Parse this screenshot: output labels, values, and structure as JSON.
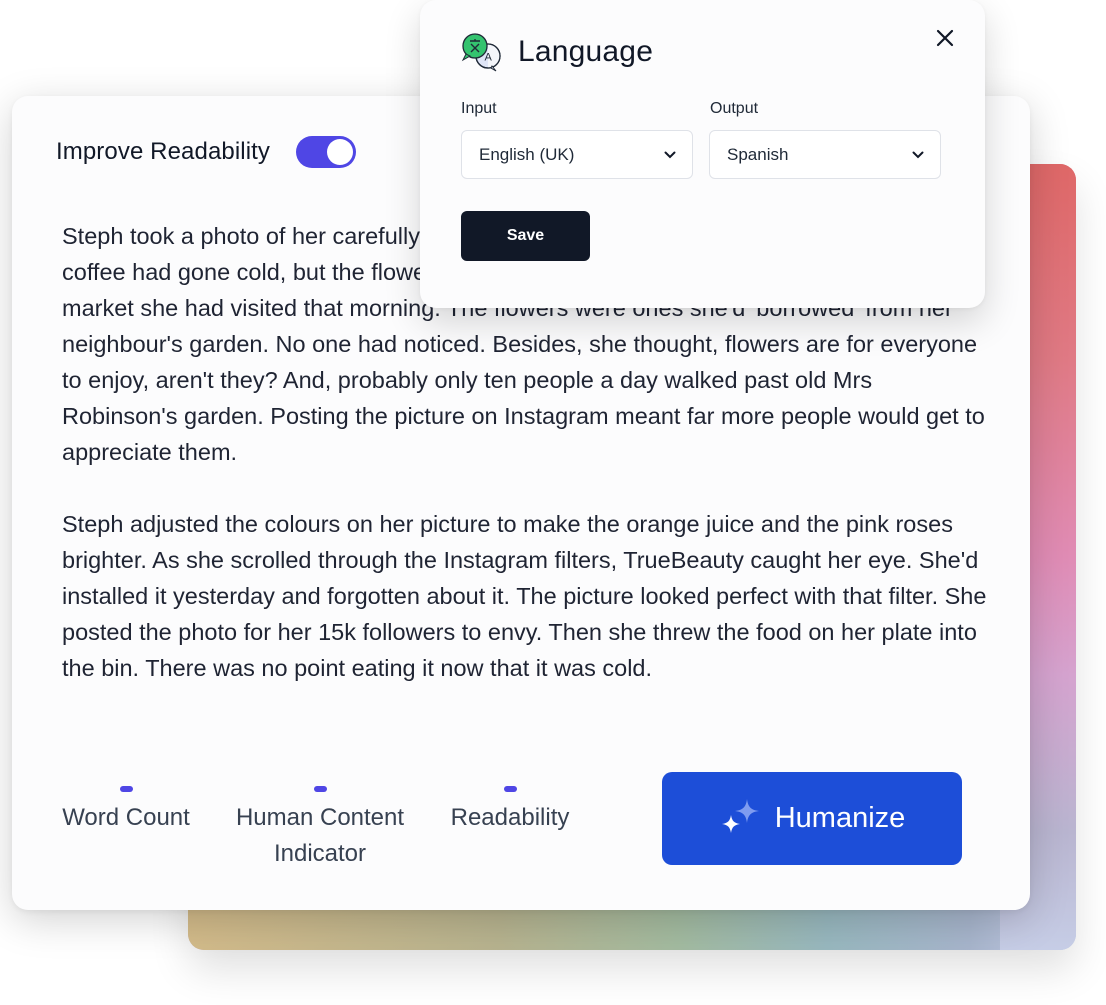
{
  "readability": {
    "label": "Improve Readability",
    "toggle_on": true
  },
  "content": {
    "paragraphs": [
      "Steph took a photo of her carefully arranged breakfast. The toast was burnt and her coffee had gone cold, but the flowers made it look like something from the expensive art market she had visited that morning. The flowers were ones she'd 'borrowed' from her neighbour's garden. No one had noticed. Besides, she thought, flowers are for everyone to enjoy, aren't they? And, probably only ten people a day walked past old Mrs Robinson's garden. Posting the picture on Instagram meant far more people would get to appreciate them.",
      "Steph adjusted the colours on her picture to make the orange juice and the pink roses brighter. As she scrolled through the Instagram filters, TrueBeauty caught her eye. She'd installed it yesterday and forgotten about it. The picture looked perfect with that filter. She posted the photo for her 15k followers to envy. Then she threw the food on her plate into the bin. There was no point eating it now that it was cold."
    ]
  },
  "metrics": [
    {
      "label": "Word Count"
    },
    {
      "label": "Human Content Indicator"
    },
    {
      "label": "Readability"
    }
  ],
  "humanize_button": {
    "label": "Humanize",
    "icon": "sparkles-icon"
  },
  "modal": {
    "title": "Language",
    "icon": "translate-icon",
    "close_icon": "close-icon",
    "input_label": "Input",
    "input_value": "English (UK)",
    "output_label": "Output",
    "output_value": "Spanish",
    "save_label": "Save"
  },
  "colors": {
    "accent": "#4f46e5",
    "primary_button": "#1d4ed8",
    "dark_button": "#111827"
  }
}
